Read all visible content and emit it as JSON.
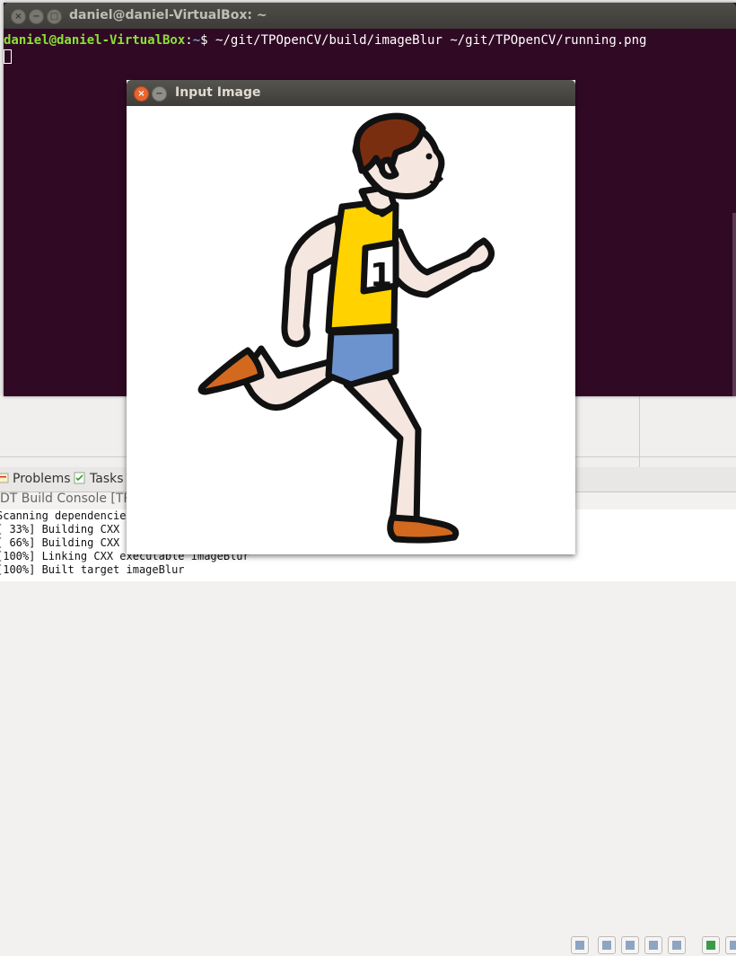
{
  "terminal": {
    "title": "daniel@daniel-VirtualBox: ~",
    "close_glyph": "×",
    "min_glyph": "−",
    "max_glyph": "□",
    "prompt_user": "daniel@daniel-VirtualBox",
    "prompt_sep": ":",
    "prompt_path": "~",
    "prompt_symbol": "$ ",
    "command": "~/git/TPOpenCV/build/imageBlur ~/git/TPOpenCV/running.png"
  },
  "image_window": {
    "title": "Input Image",
    "close_glyph": "×",
    "min_glyph": "−",
    "bib_number": "1"
  },
  "ide": {
    "tabs": [
      {
        "label": "Problems",
        "icon": "problems-icon"
      },
      {
        "label": "Tasks",
        "icon": "tasks-icon"
      }
    ],
    "console_title": "DT Build Console [TPC",
    "console_lines": [
      "Scanning dependencie",
      "[ 33%] Building CXX",
      "[ 66%] Building CXX",
      "[100%] Linking CXX executable imageBlur",
      "[100%] Built target imageBlur"
    ]
  },
  "colors": {
    "terminal_bg": "#300a24",
    "prompt_user": "#8ae234",
    "prompt_path": "#729fcf",
    "close_button": "#e8652f"
  }
}
